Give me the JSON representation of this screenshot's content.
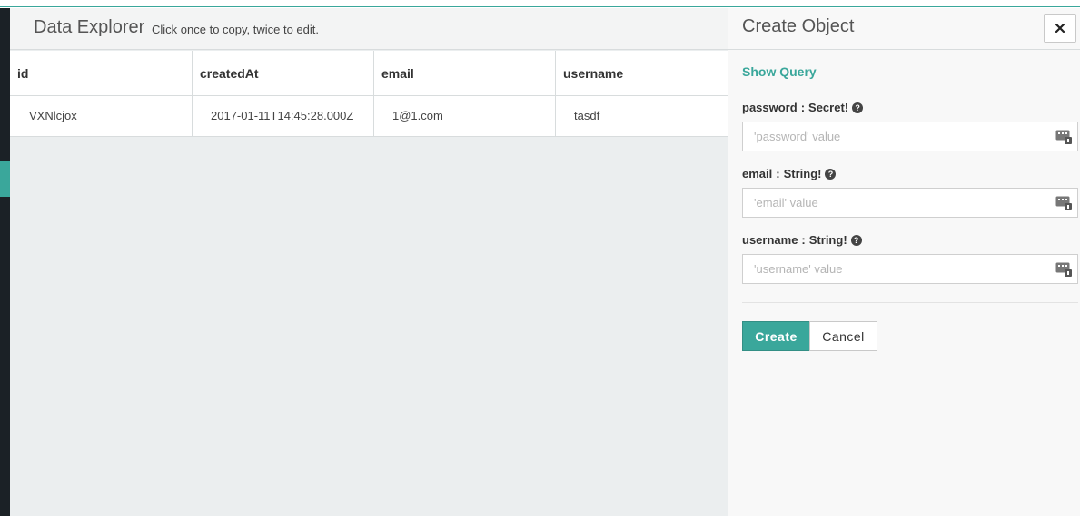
{
  "explorer": {
    "title": "Data Explorer",
    "hint": "Click once to copy, twice to edit."
  },
  "table": {
    "columns": [
      "id",
      "createdAt",
      "email",
      "username"
    ],
    "rows": [
      [
        "VXNlcjox",
        "2017-01-11T14:45:28.000Z",
        "1@1.com",
        "tasdf"
      ]
    ]
  },
  "panel": {
    "title": "Create Object",
    "close_icon": "close-icon",
    "show_query": "Show Query",
    "fields": [
      {
        "name": "password",
        "type": "Secret!",
        "placeholder": "'password' value",
        "value": ""
      },
      {
        "name": "email",
        "type": "String!",
        "placeholder": "'email' value",
        "value": ""
      },
      {
        "name": "username",
        "type": "String!",
        "placeholder": "'username' value",
        "value": ""
      }
    ],
    "create_label": "Create",
    "cancel_label": "Cancel"
  },
  "colors": {
    "accent": "#3aa79b",
    "rail": "#1b2126",
    "explorer_bg": "#ebeeef"
  }
}
